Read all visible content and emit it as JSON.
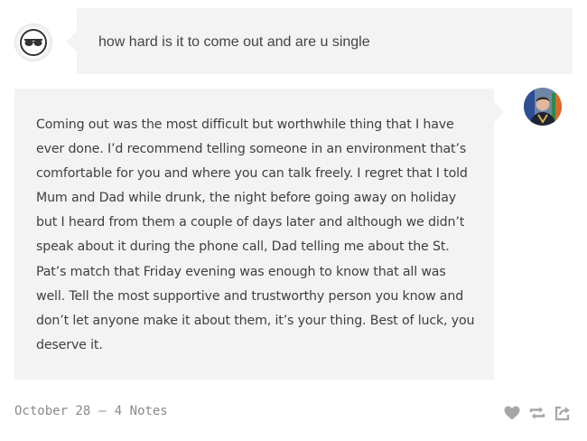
{
  "question": {
    "text": "how hard is it to come out and are u single",
    "avatar_icon": "sunglasses-icon"
  },
  "answer": {
    "paragraph": "Coming out was the most difficult but worthwhile thing that I have ever done. I’d recommend telling someone in an environment that’s comfortable for you and where you can talk freely. I regret that I told Mum and Dad while drunk, the night before going away on holiday but I heard from them a couple of days later and although we didn’t speak about it during the phone call, Dad telling me about the St. Pat’s match that Friday evening was enough to know that all was well. Tell the most supportive and trustworthy person you know and don’t let anyone make it about them, it’s your thing. Best of luck, you deserve it."
  },
  "footer": {
    "date": "October 28",
    "separator": "–",
    "notes": "4 Notes",
    "actions": [
      "heart-icon",
      "reblog-icon",
      "share-icon"
    ]
  },
  "colors": {
    "bubble": "#f3f3f3",
    "text": "#3f3f3f",
    "meta": "#8a8a8a",
    "icon": "#a6a6a6"
  }
}
